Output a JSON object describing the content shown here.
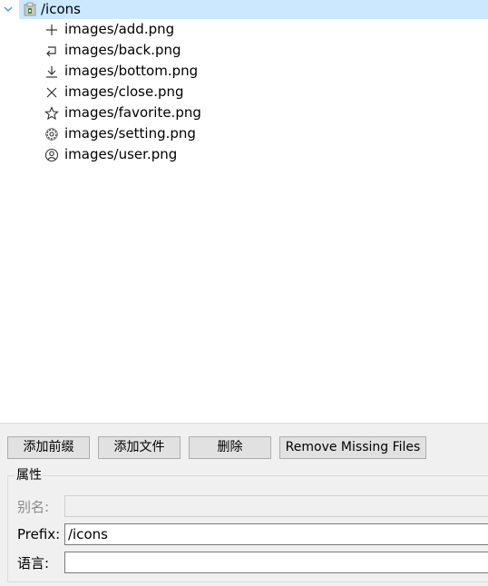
{
  "tree": {
    "root": {
      "label": "/icons",
      "icon": "resource-folder-icon",
      "expanded": true
    },
    "children": [
      {
        "label": "images/add.png",
        "icon": "plus-icon"
      },
      {
        "label": "images/back.png",
        "icon": "back-arrow-icon"
      },
      {
        "label": "images/bottom.png",
        "icon": "download-arrow-icon"
      },
      {
        "label": "images/close.png",
        "icon": "close-icon"
      },
      {
        "label": "images/favorite.png",
        "icon": "star-icon"
      },
      {
        "label": "images/setting.png",
        "icon": "gear-icon"
      },
      {
        "label": "images/user.png",
        "icon": "user-icon"
      }
    ]
  },
  "toolbar": {
    "add_prefix": "添加前缀",
    "add_files": "添加文件",
    "delete": "删除",
    "remove_missing": "Remove Missing Files"
  },
  "properties": {
    "title": "属性",
    "alias_label": "别名:",
    "alias_value": "",
    "prefix_label": "Prefix:",
    "prefix_value": "/icons",
    "language_label": "语言:",
    "language_value": ""
  },
  "colors": {
    "selection": "#cce8ff",
    "panel_bg": "#f0f0f0",
    "button_bg": "#e1e1e1",
    "expand_arrow": "#3c9bd6"
  }
}
